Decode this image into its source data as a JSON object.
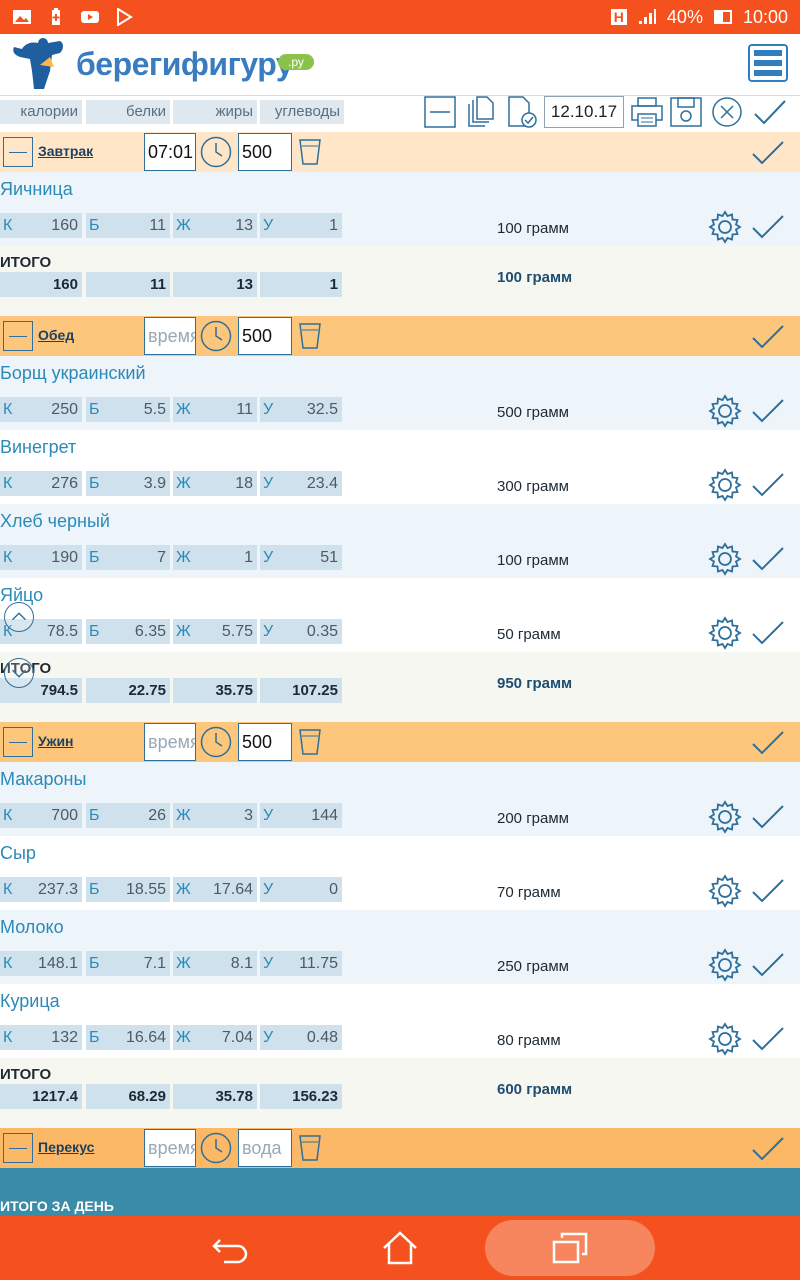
{
  "status_bar": {
    "battery": "40%",
    "time": "10:00",
    "network_badge": "H"
  },
  "header": {
    "logo_text": "берегифигуру",
    "logo_suffix": ".ру"
  },
  "toolbar": {
    "columns": [
      "калории",
      "белки",
      "жиры",
      "углеводы"
    ],
    "date": "12.10.17"
  },
  "labels": {
    "k": "К",
    "b": "Б",
    "zh": "Ж",
    "u": "У",
    "total": "ИТОГО",
    "time_placeholder": "время",
    "water_placeholder": "вода"
  },
  "meals": [
    {
      "name": "Завтрак",
      "time": "07:01",
      "water": "500",
      "foods": [
        {
          "name": "Яичница",
          "k": "160",
          "b": "11",
          "zh": "13",
          "u": "1",
          "weight": "100 грамм"
        }
      ],
      "total": {
        "k": "160",
        "b": "11",
        "zh": "13",
        "u": "1",
        "weight": "100 грамм"
      }
    },
    {
      "name": "Обед",
      "time": "",
      "water": "500",
      "foods": [
        {
          "name": "Борщ украинский",
          "k": "250",
          "b": "5.5",
          "zh": "11",
          "u": "32.5",
          "weight": "500 грамм"
        },
        {
          "name": "Винегрет",
          "k": "276",
          "b": "3.9",
          "zh": "18",
          "u": "23.4",
          "weight": "300 грамм"
        },
        {
          "name": "Хлеб черный",
          "k": "190",
          "b": "7",
          "zh": "1",
          "u": "51",
          "weight": "100 грамм"
        },
        {
          "name": "Яйцо",
          "k": "78.5",
          "b": "6.35",
          "zh": "5.75",
          "u": "0.35",
          "weight": "50 грамм"
        }
      ],
      "total": {
        "k": "794.5",
        "b": "22.75",
        "zh": "35.75",
        "u": "107.25",
        "weight": "950 грамм"
      }
    },
    {
      "name": "Ужин",
      "time": "",
      "water": "500",
      "foods": [
        {
          "name": "Макароны",
          "k": "700",
          "b": "26",
          "zh": "3",
          "u": "144",
          "weight": "200 грамм"
        },
        {
          "name": "Сыр",
          "k": "237.3",
          "b": "18.55",
          "zh": "17.64",
          "u": "0",
          "weight": "70 грамм"
        },
        {
          "name": "Молоко",
          "k": "148.1",
          "b": "7.1",
          "zh": "8.1",
          "u": "11.75",
          "weight": "250 грамм"
        },
        {
          "name": "Курица",
          "k": "132",
          "b": "16.64",
          "zh": "7.04",
          "u": "0.48",
          "weight": "80 грамм"
        }
      ],
      "total": {
        "k": "1217.4",
        "b": "68.29",
        "zh": "35.78",
        "u": "156.23",
        "weight": "600 грамм"
      }
    },
    {
      "name": "Перекус",
      "time": "",
      "water": "",
      "foods": [],
      "total": null
    }
  ],
  "day_total_label": "ИТОГО ЗА ДЕНЬ",
  "colors": {
    "status": "#f4511e",
    "accent": "#2b8ab8",
    "meal_light": "#ffe6c8",
    "meal_orange": "#fcc77c",
    "day_total": "#3a8ca8"
  }
}
